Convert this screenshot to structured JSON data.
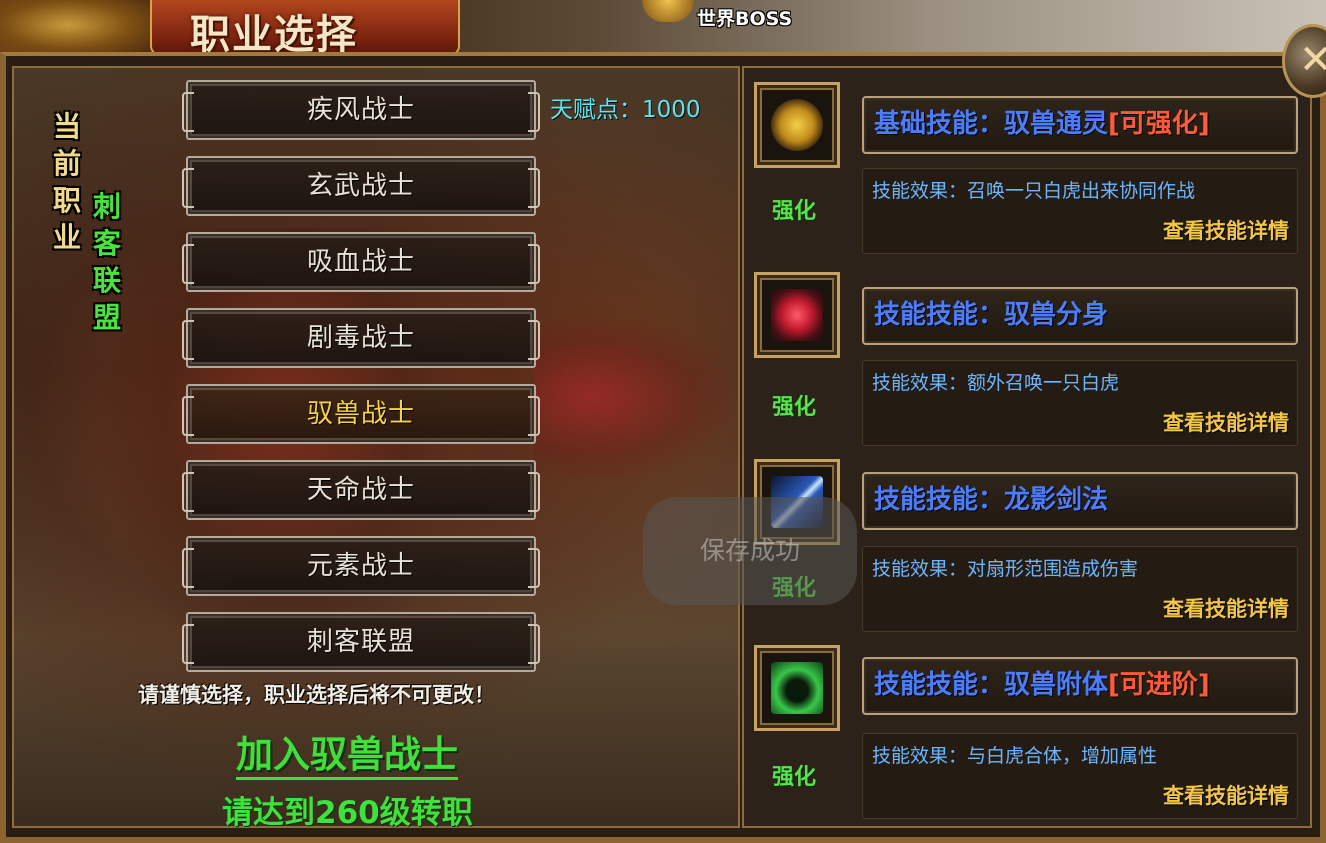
{
  "header": {
    "title": "职业选择",
    "world_boss": "世界BOSS",
    "close_symbol": "✕"
  },
  "current": {
    "label_chars": [
      "当",
      "前",
      "职",
      "业"
    ],
    "class_chars": [
      "刺",
      "客",
      "联",
      "盟"
    ]
  },
  "talent_points": "天赋点：1000",
  "classes": [
    {
      "label": "疾风战士",
      "selected": false
    },
    {
      "label": "玄武战士",
      "selected": false
    },
    {
      "label": "吸血战士",
      "selected": false
    },
    {
      "label": "剧毒战士",
      "selected": false
    },
    {
      "label": "驭兽战士",
      "selected": true
    },
    {
      "label": "天命战士",
      "selected": false
    },
    {
      "label": "元素战士",
      "selected": false
    },
    {
      "label": "刺客联盟",
      "selected": false
    }
  ],
  "warning": "请谨慎选择，职业选择后将不可更改！",
  "join_button": "加入驭兽战士",
  "requirement": "请达到260级转职",
  "toast": "保存成功",
  "skills": [
    {
      "icon": "lion-head-icon",
      "enhance": "强化",
      "title": "基础技能：驭兽通灵",
      "tag": "[可强化]",
      "effect": "技能效果：召唤一只白虎出来协同作战",
      "detail": "查看技能详情"
    },
    {
      "icon": "red-rose-icon",
      "enhance": "强化",
      "title": "技能技能：驭兽分身",
      "tag": "",
      "effect": "技能效果：额外召唤一只白虎",
      "detail": "查看技能详情"
    },
    {
      "icon": "sword-slash-icon",
      "enhance": "强化",
      "title": "技能技能：龙影剑法",
      "tag": "",
      "effect": "技能效果：对扇形范围造成伤害",
      "detail": "查看技能详情"
    },
    {
      "icon": "spirit-silhouette-icon",
      "enhance": "强化",
      "title": "技能技能：驭兽附体",
      "tag": "[可进阶]",
      "effect": "技能效果：与白虎合体，增加属性",
      "detail": "查看技能详情"
    }
  ],
  "colors": {
    "selected_class": "#f7d24a",
    "enhance_green": "#54e64a",
    "skill_name_blue": "#4c7dff",
    "skill_tag_red": "#ff5a3a",
    "detail_gold": "#f2c64a",
    "talent_cyan": "#58e7f2"
  }
}
